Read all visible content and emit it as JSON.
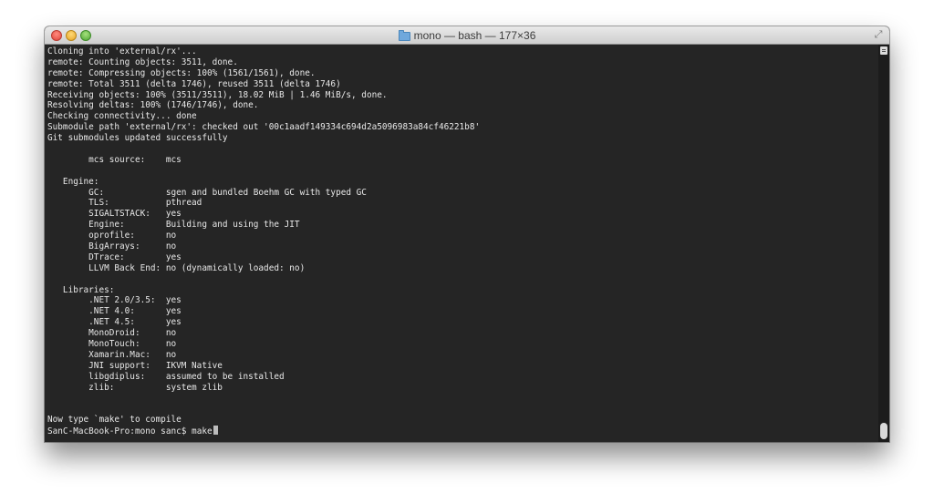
{
  "window": {
    "title": "mono — bash — 177×36"
  },
  "terminal": {
    "lines": [
      "Cloning into 'external/rx'...",
      "remote: Counting objects: 3511, done.",
      "remote: Compressing objects: 100% (1561/1561), done.",
      "remote: Total 3511 (delta 1746), reused 3511 (delta 1746)",
      "Receiving objects: 100% (3511/3511), 18.02 MiB | 1.46 MiB/s, done.",
      "Resolving deltas: 100% (1746/1746), done.",
      "Checking connectivity... done",
      "Submodule path 'external/rx': checked out '00c1aadf149334c694d2a5096983a84cf46221b8'",
      "Git submodules updated successfully",
      "",
      "        mcs source:    mcs",
      "",
      "   Engine:",
      "        GC:            sgen and bundled Boehm GC with typed GC",
      "        TLS:           pthread",
      "        SIGALTSTACK:   yes",
      "        Engine:        Building and using the JIT",
      "        oprofile:      no",
      "        BigArrays:     no",
      "        DTrace:        yes",
      "        LLVM Back End: no (dynamically loaded: no)",
      "",
      "   Libraries:",
      "        .NET 2.0/3.5:  yes",
      "        .NET 4.0:      yes",
      "        .NET 4.5:      yes",
      "        MonoDroid:     no",
      "        MonoTouch:     no",
      "        Xamarin.Mac:   no",
      "        JNI support:   IKVM Native",
      "        libgdiplus:    assumed to be installed",
      "        zlib:          system zlib",
      "",
      "",
      "Now type `make' to compile"
    ],
    "prompt": "SanC-MacBook-Pro:mono sanc$ ",
    "command": "make"
  },
  "icons": {
    "close": "close-icon",
    "minimize": "minimize-icon",
    "zoom": "zoom-icon",
    "folder": "folder-icon",
    "fullscreen": "fullscreen-icon"
  }
}
